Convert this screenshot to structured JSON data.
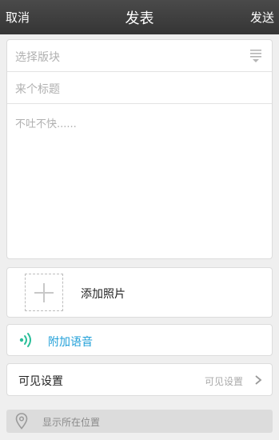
{
  "header": {
    "cancel_label": "取消",
    "title": "发表",
    "send_label": "发送"
  },
  "compose": {
    "board_placeholder": "选择版块",
    "title_placeholder": "来个标题",
    "body_placeholder": "不吐不快......"
  },
  "photo": {
    "label": "添加照片"
  },
  "voice": {
    "label": "附加语音"
  },
  "visibility": {
    "label": "可见设置",
    "value": "可见设置"
  },
  "location": {
    "label": "显示所在位置"
  },
  "colors": {
    "header_bg": "#3d3d3d",
    "accent": "#1f9fd8",
    "voice_icon": "#2bbf9a"
  },
  "icons": {
    "board": "filter-icon",
    "add_photo": "plus-icon",
    "voice": "sound-wave-icon",
    "visibility": "chevron-right-icon",
    "location": "location-pin-icon"
  }
}
